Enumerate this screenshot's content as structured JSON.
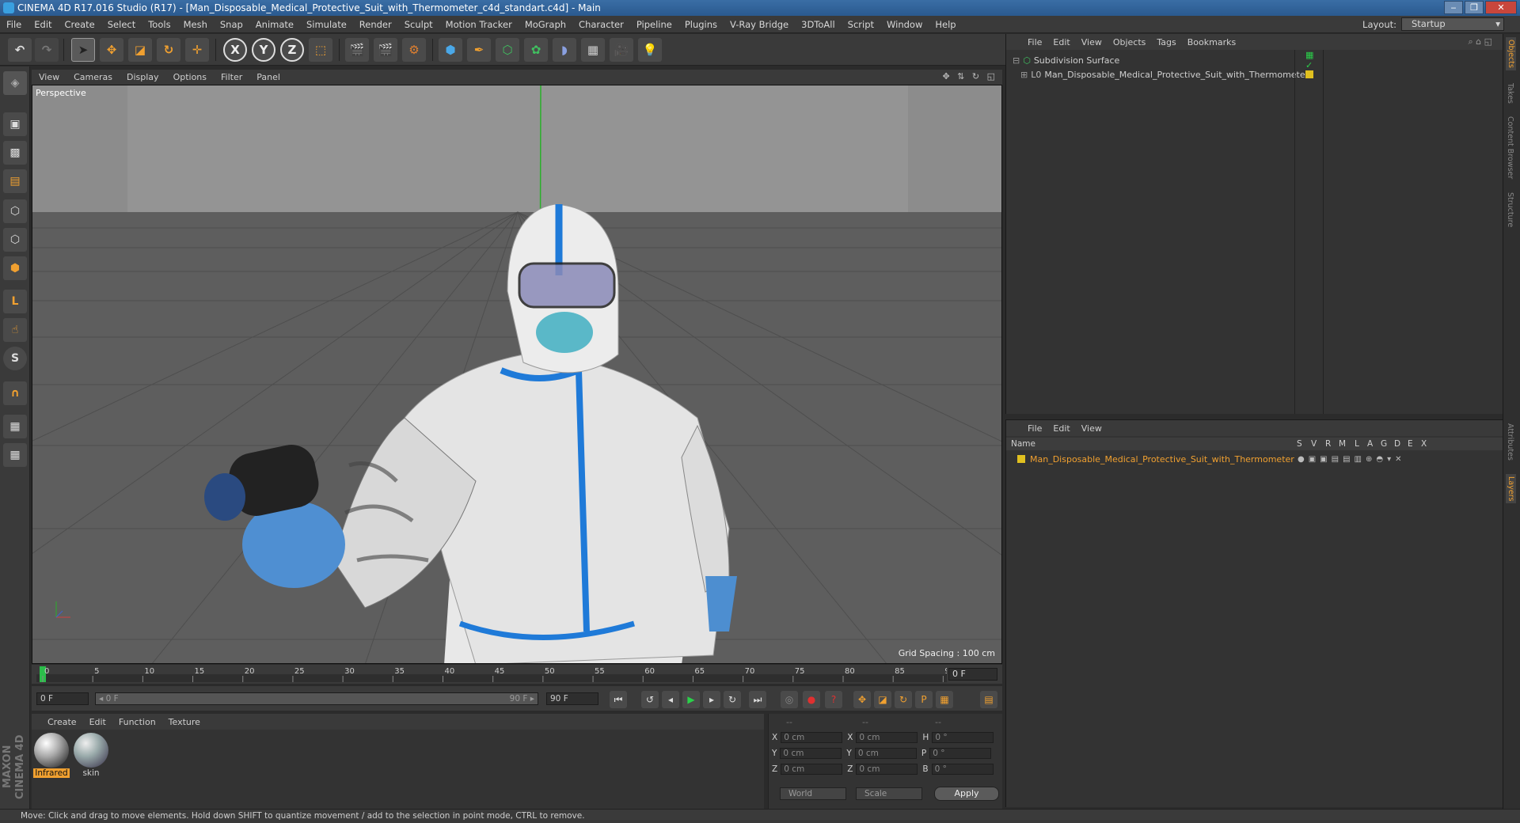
{
  "window": {
    "title": "CINEMA 4D R17.016 Studio (R17) - [Man_Disposable_Medical_Protective_Suit_with_Thermometer_c4d_standart.c4d] - Main",
    "minimize": "‒",
    "maximize": "❐",
    "close": "✕"
  },
  "menu": [
    "File",
    "Edit",
    "Create",
    "Select",
    "Tools",
    "Mesh",
    "Snap",
    "Animate",
    "Simulate",
    "Render",
    "Sculpt",
    "Motion Tracker",
    "MoGraph",
    "Character",
    "Pipeline",
    "Plugins",
    "V-Ray Bridge",
    "3DToAll",
    "Script",
    "Window",
    "Help"
  ],
  "layout": {
    "label": "Layout:",
    "value": "Startup"
  },
  "toolbar": {
    "axis_x": "X",
    "axis_y": "Y",
    "axis_z": "Z"
  },
  "viewport": {
    "menu": [
      "View",
      "Cameras",
      "Display",
      "Options",
      "Filter",
      "Panel"
    ],
    "camera_label": "Perspective",
    "grid_spacing": "Grid Spacing : 100 cm",
    "nav_icons": "✥ ⇅ ↻ ◱"
  },
  "timeline": {
    "ticks": [
      "0",
      "5",
      "10",
      "15",
      "20",
      "25",
      "30",
      "35",
      "40",
      "45",
      "50",
      "55",
      "60",
      "65",
      "70",
      "75",
      "80",
      "85",
      "90"
    ],
    "current_frame": "0 F",
    "start": "0 F",
    "range_start": "◂ 0 F",
    "range_end": "90 F ▸",
    "end": "90 F"
  },
  "materials": {
    "menu": [
      "Create",
      "Edit",
      "Function",
      "Texture"
    ],
    "items": [
      {
        "name": "Infrared",
        "selected": true
      },
      {
        "name": "skin",
        "selected": false
      }
    ]
  },
  "coordinates": {
    "headers": [
      "--",
      "--",
      "--"
    ],
    "rows": [
      {
        "a": "X",
        "av": "0 cm",
        "b": "X",
        "bv": "0 cm",
        "c": "H",
        "cv": "0 °"
      },
      {
        "a": "Y",
        "av": "0 cm",
        "b": "Y",
        "bv": "0 cm",
        "c": "P",
        "cv": "0 °"
      },
      {
        "a": "Z",
        "av": "0 cm",
        "b": "Z",
        "bv": "0 cm",
        "c": "B",
        "cv": "0 °"
      }
    ],
    "mode": "World",
    "size_mode": "Scale",
    "apply": "Apply"
  },
  "status": "Move: Click and drag to move elements. Hold down SHIFT to quantize movement / add to the selection in point mode, CTRL to remove.",
  "objects": {
    "menu": [
      "File",
      "Edit",
      "View",
      "Objects",
      "Tags",
      "Bookmarks"
    ],
    "items": [
      {
        "name": "Subdivision Surface"
      },
      {
        "name": "Man_Disposable_Medical_Protective_Suit_with_Thermometer"
      }
    ]
  },
  "layers": {
    "menu": [
      "File",
      "Edit",
      "View"
    ],
    "header_name": "Name",
    "columns": [
      "S",
      "V",
      "R",
      "M",
      "L",
      "A",
      "G",
      "D",
      "E",
      "X"
    ],
    "items": [
      {
        "name": "Man_Disposable_Medical_Protective_Suit_with_Thermometer",
        "color": "#e0c020"
      }
    ]
  },
  "side_tabs": [
    "Objects",
    "Takes",
    "Content Browser",
    "Structure",
    "Attributes",
    "Layers"
  ],
  "maxon": "MAXON CINEMA 4D",
  "colors": {
    "accent": "#f0a030",
    "selected_text": "#f0a030",
    "titlebar": "#2a5a8f"
  }
}
